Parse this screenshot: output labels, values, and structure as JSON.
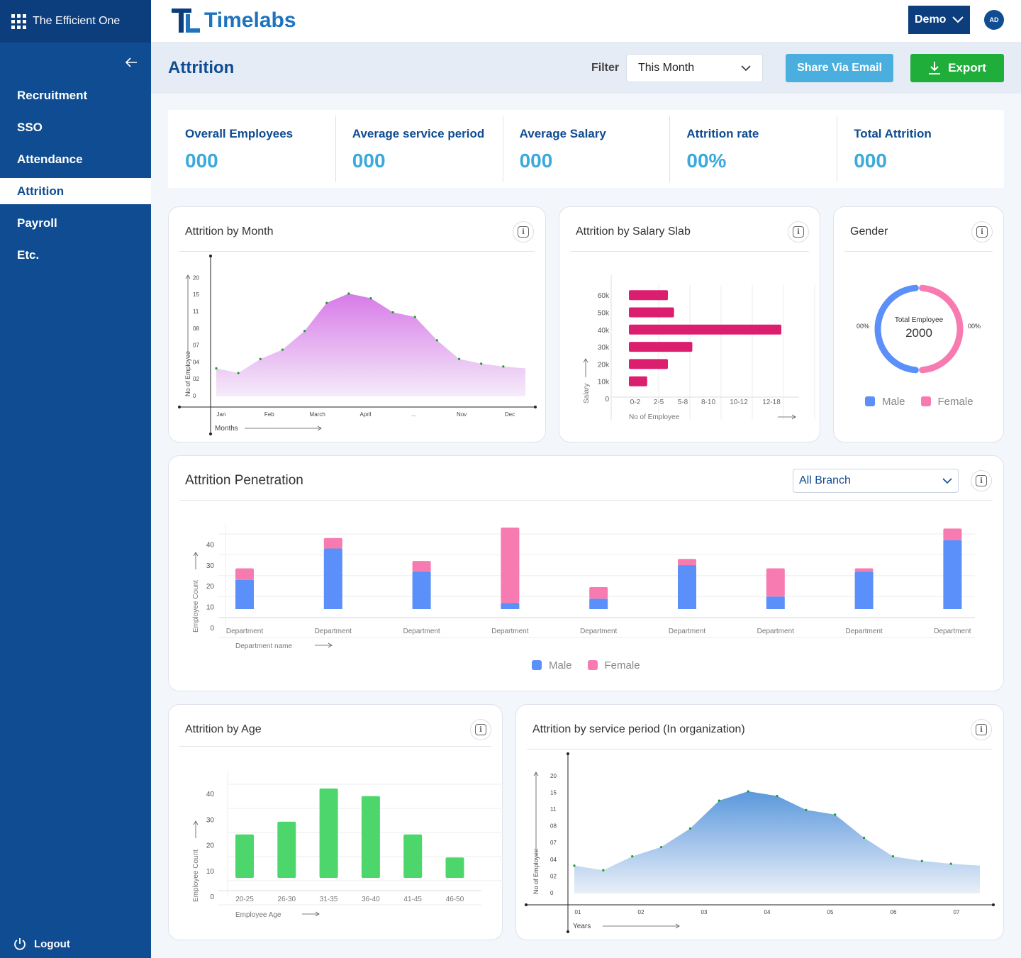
{
  "sidebar": {
    "app_name": "The Efficient One",
    "items": [
      {
        "label": "Recruitment"
      },
      {
        "label": "SSO"
      },
      {
        "label": "Attendance"
      },
      {
        "label": "Attrition"
      },
      {
        "label": "Payroll"
      },
      {
        "label": "Etc."
      }
    ],
    "logout": "Logout"
  },
  "topbar": {
    "logo": "Timelabs",
    "account": "Demo",
    "avatar": "AD"
  },
  "header": {
    "title": "Attrition",
    "filter_label": "Filter",
    "filter_value": "This Month",
    "share": "Share Via Email",
    "export": "Export"
  },
  "stats": [
    {
      "label": "Overall Employees",
      "value": "000"
    },
    {
      "label": "Average service period",
      "value": "000"
    },
    {
      "label": "Average Salary",
      "value": "000"
    },
    {
      "label": "Attrition rate",
      "value": "00%"
    },
    {
      "label": "Total Attrition",
      "value": "000"
    }
  ],
  "colors": {
    "primary": "#0f4c91",
    "accent": "#3aa9dc",
    "male": "#5b8ff9",
    "female": "#f77bb0",
    "age": "#4cd66b",
    "salary": "#dc1e6e"
  },
  "chart_data": [
    {
      "type": "area",
      "title": "Attrition by Month",
      "xlabel": "Months",
      "ylabel": "No of Employee",
      "x_ticks": [
        "Jan",
        "Feb",
        "March",
        "April",
        "...",
        "Nov",
        "Dec"
      ],
      "y_ticks": [
        "0",
        "02",
        "04",
        "07",
        "08",
        "11",
        "15",
        "20"
      ],
      "values": [
        3,
        2.5,
        4,
        5,
        7,
        10,
        11,
        10.5,
        9,
        8.5,
        6,
        4,
        3.5,
        3.2,
        3
      ]
    },
    {
      "type": "bar",
      "title": "Attrition by Salary Slab",
      "xlabel": "No of Employee",
      "ylabel": "Salary",
      "categories": [
        "10k",
        "20k",
        "30k",
        "40k",
        "50k",
        "60k"
      ],
      "x_ticks": [
        "0-2",
        "2-5",
        "5-8",
        "8-10",
        "10-12",
        "12-18"
      ],
      "y_ticks": [
        "0",
        "10k",
        "20k",
        "30k",
        "40k",
        "50k",
        "60k"
      ],
      "values": [
        1.5,
        3.2,
        5.2,
        12.5,
        3.7,
        3.2
      ]
    },
    {
      "type": "pie",
      "title": "Gender",
      "center_label": "Total Employee",
      "center_value": "2000",
      "series": [
        {
          "name": "Male",
          "value": 50,
          "label": "00%"
        },
        {
          "name": "Female",
          "value": 50,
          "label": "00%"
        }
      ]
    },
    {
      "type": "bar",
      "title": "Attrition Penetration",
      "filter": "All Branch",
      "xlabel": "Department name",
      "ylabel": "Employee Count",
      "categories": [
        "Department",
        "Department",
        "Department",
        "Department",
        "Department",
        "Department",
        "Department",
        "Department",
        "Department"
      ],
      "y_ticks": [
        "0",
        "10",
        "20",
        "30",
        "40"
      ],
      "series": [
        {
          "name": "Male",
          "values": [
            14,
            29,
            18,
            3,
            5,
            21,
            6,
            18,
            33
          ]
        },
        {
          "name": "Female",
          "values": [
            5.5,
            5,
            5,
            36,
            5.5,
            3,
            13.5,
            1.5,
            5.5
          ]
        }
      ]
    },
    {
      "type": "bar",
      "title": "Attrition by Age",
      "xlabel": "Employee Age",
      "ylabel": "Employee Count",
      "categories": [
        "20-25",
        "26-30",
        "31-35",
        "36-40",
        "41-45",
        "46-50"
      ],
      "y_ticks": [
        "0",
        "10",
        "20",
        "30",
        "40"
      ],
      "values": [
        17,
        22,
        35,
        32,
        17,
        8
      ]
    },
    {
      "type": "area",
      "title": "Attrition by service period (In organization)",
      "xlabel": "Years",
      "ylabel": "No of Employee",
      "x_ticks": [
        "01",
        "02",
        "03",
        "04",
        "05",
        "06",
        "07"
      ],
      "y_ticks": [
        "0",
        "02",
        "04",
        "07",
        "08",
        "11",
        "15",
        "20"
      ],
      "values": [
        3,
        2.5,
        4,
        5,
        7,
        10,
        11,
        10.5,
        9,
        8.5,
        6,
        4,
        3.5,
        3.2,
        3
      ]
    }
  ]
}
